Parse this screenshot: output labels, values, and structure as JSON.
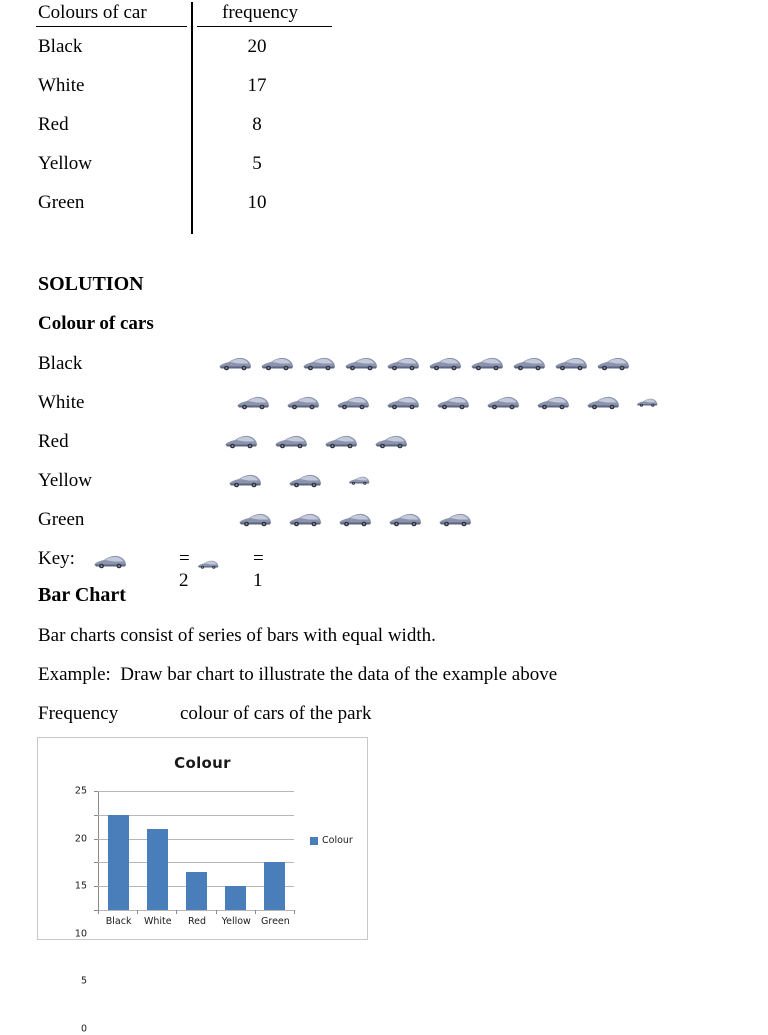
{
  "table": {
    "header": {
      "col1": "Colours of car",
      "col2": "frequency"
    },
    "rows": [
      {
        "name": "Black",
        "value": "20"
      },
      {
        "name": "White",
        "value": "17"
      },
      {
        "name": "Red",
        "value": "8"
      },
      {
        "name": "Yellow",
        "value": "5"
      },
      {
        "name": "Green",
        "value": "10"
      }
    ]
  },
  "solution": {
    "heading": "SOLUTION",
    "pictogram_heading": "Colour of cars",
    "rows": [
      {
        "label": "Black",
        "full_cars": 10,
        "half_cars": 0,
        "offset": 180,
        "spacing": "normal"
      },
      {
        "label": "White",
        "full_cars": 8,
        "half_cars": 1,
        "offset": 198,
        "spacing": "mid"
      },
      {
        "label": "Red",
        "full_cars": 4,
        "half_cars": 0,
        "offset": 186,
        "spacing": "mid"
      },
      {
        "label": "Yellow",
        "full_cars": 2,
        "half_cars": 1,
        "offset": 190,
        "spacing": "wide"
      },
      {
        "label": "Green",
        "full_cars": 5,
        "half_cars": 0,
        "offset": 200,
        "spacing": "mid"
      }
    ]
  },
  "key": {
    "word": "Key:",
    "equals_full": "= 2",
    "equals_half": "= 1"
  },
  "bar_chart_section": {
    "heading": "Bar Chart",
    "definition": "Bar charts consist of series of bars with equal width.",
    "example": "Example:  Draw bar chart to illustrate the data of the example above",
    "axes_line": "Frequency             colour of cars of the park"
  },
  "colors": {
    "bar_blue": "#4a7ebb",
    "gridline": "#b7b7b7",
    "chart_border": "#c8c8c8",
    "car_body": "#8c94ad",
    "car_shade": "#5b6480",
    "car_window": "#c3cadb"
  },
  "chart_data": {
    "type": "bar",
    "title": "Colour",
    "categories": [
      "Black",
      "White",
      "Red",
      "Yellow",
      "Green"
    ],
    "values": [
      20,
      17,
      8,
      5,
      10
    ],
    "series": [
      {
        "name": "Colour",
        "values": [
          20,
          17,
          8,
          5,
          10
        ]
      }
    ],
    "legend": [
      "Colour"
    ],
    "legend_position": "right",
    "yticks": [
      0,
      5,
      10,
      15,
      20,
      25
    ],
    "ylim": [
      0,
      25
    ],
    "xlabel": "",
    "ylabel": "",
    "grid": true
  }
}
